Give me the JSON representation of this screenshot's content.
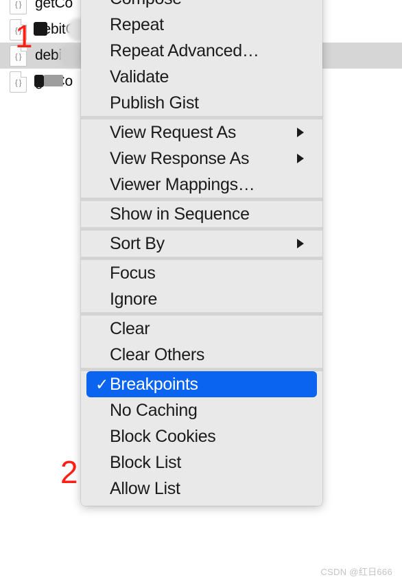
{
  "colors": {
    "menu_background": "#e9e9e9",
    "menu_separator": "#d4d4d4",
    "highlight": "#0a64ef",
    "highlight_text": "#ffffff",
    "row_selected": "#d6d6d6",
    "annotation_red": "#ff1f15",
    "watermark": "#c3c3c3",
    "text": "#1b1b1b"
  },
  "request_list": {
    "rows": [
      {
        "icon": "json-file-icon",
        "label": "getCo",
        "selected": false,
        "cutoff": true
      },
      {
        "icon": "json-file-icon",
        "label": "debitC",
        "selected": false,
        "cutoff": false
      },
      {
        "icon": "json-file-icon",
        "label": "debitC",
        "selected": true,
        "cutoff": false
      },
      {
        "icon": "json-file-icon",
        "label": "getCo",
        "selected": false,
        "cutoff": false
      }
    ],
    "icon_glyph": "{ }"
  },
  "context_menu": {
    "sections": [
      {
        "name": "compose-section",
        "items": [
          {
            "label": "Compose",
            "checked": false,
            "submenu": false
          },
          {
            "label": "Repeat",
            "checked": false,
            "submenu": false
          },
          {
            "label": "Repeat Advanced…",
            "checked": false,
            "submenu": false
          },
          {
            "label": "Validate",
            "checked": false,
            "submenu": false
          },
          {
            "label": "Publish Gist",
            "checked": false,
            "submenu": false
          }
        ]
      },
      {
        "name": "view-section",
        "items": [
          {
            "label": "View Request As",
            "checked": false,
            "submenu": true
          },
          {
            "label": "View Response As",
            "checked": false,
            "submenu": true
          },
          {
            "label": "Viewer Mappings…",
            "checked": false,
            "submenu": false
          }
        ]
      },
      {
        "name": "sequence-section",
        "items": [
          {
            "label": "Show in Sequence",
            "checked": false,
            "submenu": false
          }
        ]
      },
      {
        "name": "sort-section",
        "items": [
          {
            "label": "Sort By",
            "checked": false,
            "submenu": true
          }
        ]
      },
      {
        "name": "focus-section",
        "items": [
          {
            "label": "Focus",
            "checked": false,
            "submenu": false
          },
          {
            "label": "Ignore",
            "checked": false,
            "submenu": false
          }
        ]
      },
      {
        "name": "clear-section",
        "items": [
          {
            "label": "Clear",
            "checked": false,
            "submenu": false
          },
          {
            "label": "Clear Others",
            "checked": false,
            "submenu": false
          }
        ]
      },
      {
        "name": "tools-section",
        "items": [
          {
            "label": "Breakpoints",
            "checked": true,
            "submenu": false,
            "highlighted": true
          },
          {
            "label": "No Caching",
            "checked": false,
            "submenu": false
          },
          {
            "label": "Block Cookies",
            "checked": false,
            "submenu": false
          },
          {
            "label": "Block List",
            "checked": false,
            "submenu": false
          },
          {
            "label": "Allow List",
            "checked": false,
            "submenu": false
          }
        ]
      }
    ],
    "checkmark_glyph": "✓"
  },
  "annotations": [
    {
      "name": "annotation-step-1",
      "text": "1"
    },
    {
      "name": "annotation-step-2",
      "text": "2"
    }
  ],
  "watermark": {
    "text": "CSDN @红日666"
  }
}
